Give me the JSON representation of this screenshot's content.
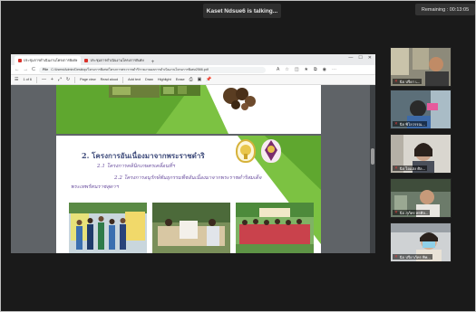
{
  "meeting": {
    "talking_indicator": "Kaset Ndsue6 is talking...",
    "remaining": "Remaining : 00:13:05"
  },
  "browser": {
    "tabs": [
      {
        "label": "ประชุมการดำเนินงานโครงการพิเศษ",
        "active": true
      },
      {
        "label": "ประชุมการดำเนินงานโครงการพิเศษ",
        "active": false
      }
    ],
    "new_tab": "+",
    "window_controls": [
      "—",
      "☐",
      "✕"
    ],
    "nav": {
      "back": "←",
      "forward": "→",
      "reload": "C"
    },
    "url_prefix": "File",
    "url": "C:/Users/Admin/Desktop/โครงการพิเศษ/โครงการพระราชดำริ/รายงานผลการดำเนินงานโครงการพิเศษ2566.pdf"
  },
  "pdf_toolbar": {
    "page_label": "1 of 6",
    "zoom_out": "—",
    "zoom_in": "+",
    "page_view": "Page view",
    "read_aloud": "Read aloud",
    "add_text": "Add text",
    "draw": "Draw",
    "highlight": "Highlight",
    "erase": "Erase"
  },
  "slide": {
    "heading": "2. โครงการอันเนื่องมาจากพระราชดำริ",
    "sub1": "2.1 โครงการคลินิกเกษตรเคลื่อนที่ฯ",
    "sub2": "2.2 โครงการอนุรักษ์พันธุกรรมพืชอันเนื่องมาจากพระราชดำริสมเด็จ",
    "sub3": "พระเทพรัตนราชสุดาฯ"
  },
  "participants": [
    {
      "name": "นิจ ปรีดา เ..."
    },
    {
      "name": "นิจ พิไลวรรณ..."
    },
    {
      "name": "นิจ ไอแสง ศิล..."
    },
    {
      "name": "นิจ สุภัทร พรศิล..."
    },
    {
      "name": "นิจ ปรียาภัทร พิพ..."
    }
  ],
  "colors": {
    "green_accent": "#7cc242",
    "heading_blue": "#3d4a7a",
    "sub_purple": "#6b4f9f",
    "mic_red": "#e23b3b"
  }
}
